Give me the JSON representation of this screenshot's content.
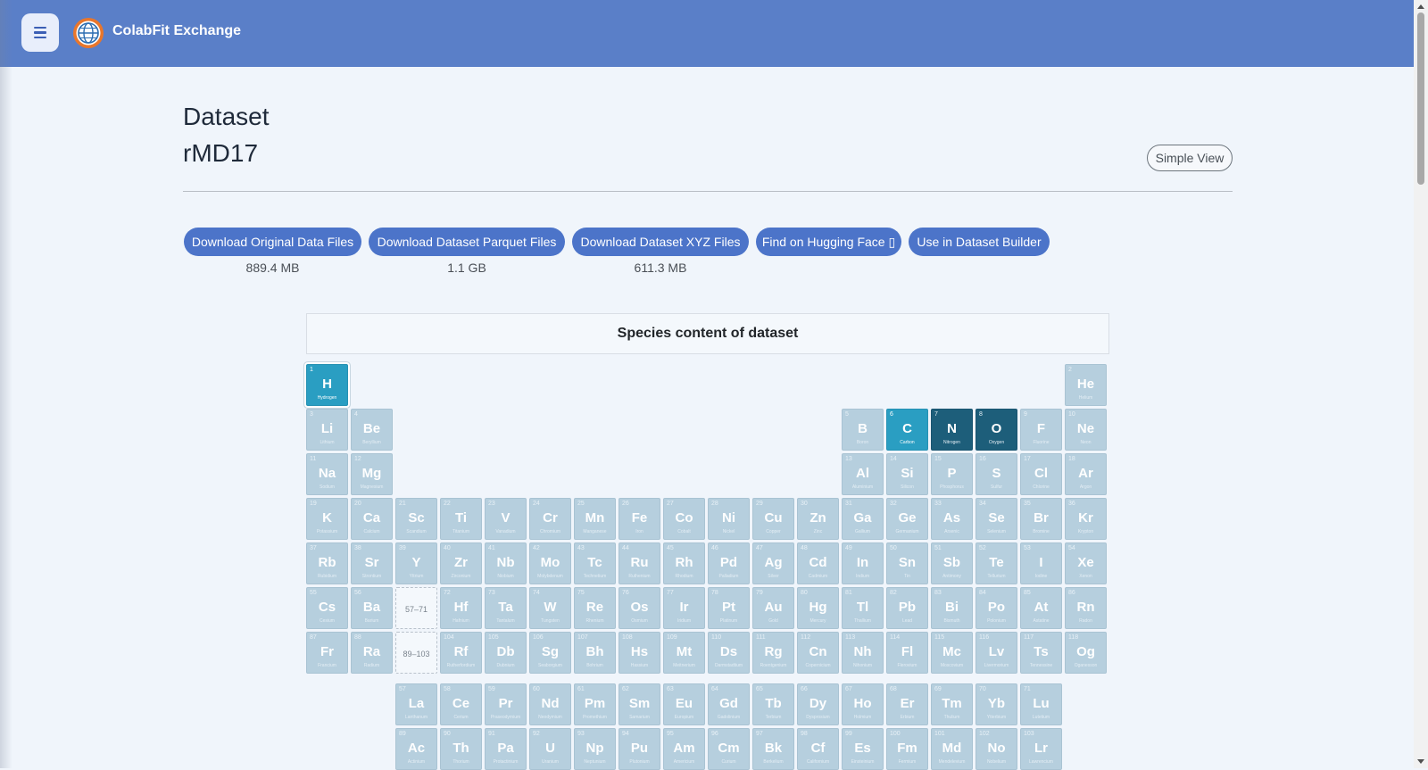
{
  "navbar": {
    "brand": "ColabFit Exchange",
    "menu_icon": "hamburger-menu-icon",
    "logo_icon": "globe-logo-icon",
    "color": "#5a7fc8"
  },
  "header": {
    "title_line1": "Dataset",
    "title_line2": "rMD17",
    "simple_view_label": "Simple View"
  },
  "downloads": [
    {
      "label": "Download Original Data Files",
      "size": "889.4 MB"
    },
    {
      "label": "Download Dataset Parquet Files",
      "size": "1.1 GB"
    },
    {
      "label": "Download Dataset XYZ Files",
      "size": "611.3 MB"
    },
    {
      "label": "Find on Hugging Face ▯",
      "size": ""
    },
    {
      "label": "Use in Dataset Builder",
      "size": ""
    }
  ],
  "species_title": "Species content of dataset",
  "colors": {
    "present": "#2a9ec2",
    "present_dark": "#1d5e7a",
    "absent": "#b6cfde"
  },
  "present_elements": [
    "H",
    "C",
    "N",
    "O"
  ],
  "elements": [
    [
      "H",
      "Hydrogen"
    ],
    [
      "He",
      "Helium"
    ],
    [
      "Li",
      "Lithium"
    ],
    [
      "Be",
      "Beryllium"
    ],
    [
      "B",
      "Boron"
    ],
    [
      "C",
      "Carbon"
    ],
    [
      "N",
      "Nitrogen"
    ],
    [
      "O",
      "Oxygen"
    ],
    [
      "F",
      "Fluorine"
    ],
    [
      "Ne",
      "Neon"
    ],
    [
      "Na",
      "Sodium"
    ],
    [
      "Mg",
      "Magnesium"
    ],
    [
      "Al",
      "Aluminium"
    ],
    [
      "Si",
      "Silicon"
    ],
    [
      "P",
      "Phosphorus"
    ],
    [
      "S",
      "Sulfur"
    ],
    [
      "Cl",
      "Chlorine"
    ],
    [
      "Ar",
      "Argon"
    ],
    [
      "K",
      "Potassium"
    ],
    [
      "Ca",
      "Calcium"
    ],
    [
      "Sc",
      "Scandium"
    ],
    [
      "Ti",
      "Titanium"
    ],
    [
      "V",
      "Vanadium"
    ],
    [
      "Cr",
      "Chromium"
    ],
    [
      "Mn",
      "Manganese"
    ],
    [
      "Fe",
      "Iron"
    ],
    [
      "Co",
      "Cobalt"
    ],
    [
      "Ni",
      "Nickel"
    ],
    [
      "Cu",
      "Copper"
    ],
    [
      "Zn",
      "Zinc"
    ],
    [
      "Ga",
      "Gallium"
    ],
    [
      "Ge",
      "Germanium"
    ],
    [
      "As",
      "Arsenic"
    ],
    [
      "Se",
      "Selenium"
    ],
    [
      "Br",
      "Bromine"
    ],
    [
      "Kr",
      "Krypton"
    ],
    [
      "Rb",
      "Rubidium"
    ],
    [
      "Sr",
      "Strontium"
    ],
    [
      "Y",
      "Yttrium"
    ],
    [
      "Zr",
      "Zirconium"
    ],
    [
      "Nb",
      "Niobium"
    ],
    [
      "Mo",
      "Molybdenum"
    ],
    [
      "Tc",
      "Technetium"
    ],
    [
      "Ru",
      "Ruthenium"
    ],
    [
      "Rh",
      "Rhodium"
    ],
    [
      "Pd",
      "Palladium"
    ],
    [
      "Ag",
      "Silver"
    ],
    [
      "Cd",
      "Cadmium"
    ],
    [
      "In",
      "Indium"
    ],
    [
      "Sn",
      "Tin"
    ],
    [
      "Sb",
      "Antimony"
    ],
    [
      "Te",
      "Tellurium"
    ],
    [
      "I",
      "Iodine"
    ],
    [
      "Xe",
      "Xenon"
    ],
    [
      "Cs",
      "Cesium"
    ],
    [
      "Ba",
      "Barium"
    ],
    [
      "La",
      "Lanthanum"
    ],
    [
      "Ce",
      "Cerium"
    ],
    [
      "Pr",
      "Praseodymium"
    ],
    [
      "Nd",
      "Neodymium"
    ],
    [
      "Pm",
      "Promethium"
    ],
    [
      "Sm",
      "Samarium"
    ],
    [
      "Eu",
      "Europium"
    ],
    [
      "Gd",
      "Gadolinium"
    ],
    [
      "Tb",
      "Terbium"
    ],
    [
      "Dy",
      "Dysprosium"
    ],
    [
      "Ho",
      "Holmium"
    ],
    [
      "Er",
      "Erbium"
    ],
    [
      "Tm",
      "Thulium"
    ],
    [
      "Yb",
      "Ytterbium"
    ],
    [
      "Lu",
      "Lutetium"
    ],
    [
      "Hf",
      "Hafnium"
    ],
    [
      "Ta",
      "Tantalum"
    ],
    [
      "W",
      "Tungsten"
    ],
    [
      "Re",
      "Rhenium"
    ],
    [
      "Os",
      "Osmium"
    ],
    [
      "Ir",
      "Iridium"
    ],
    [
      "Pt",
      "Platinum"
    ],
    [
      "Au",
      "Gold"
    ],
    [
      "Hg",
      "Mercury"
    ],
    [
      "Tl",
      "Thallium"
    ],
    [
      "Pb",
      "Lead"
    ],
    [
      "Bi",
      "Bismuth"
    ],
    [
      "Po",
      "Polonium"
    ],
    [
      "At",
      "Astatine"
    ],
    [
      "Rn",
      "Radon"
    ],
    [
      "Fr",
      "Francium"
    ],
    [
      "Ra",
      "Radium"
    ],
    [
      "Ac",
      "Actinium"
    ],
    [
      "Th",
      "Thorium"
    ],
    [
      "Pa",
      "Protactinium"
    ],
    [
      "U",
      "Uranium"
    ],
    [
      "Np",
      "Neptunium"
    ],
    [
      "Pu",
      "Plutonium"
    ],
    [
      "Am",
      "Americium"
    ],
    [
      "Cm",
      "Curium"
    ],
    [
      "Bk",
      "Berkelium"
    ],
    [
      "Cf",
      "Californium"
    ],
    [
      "Es",
      "Einsteinium"
    ],
    [
      "Fm",
      "Fermium"
    ],
    [
      "Md",
      "Mendelevium"
    ],
    [
      "No",
      "Nobelium"
    ],
    [
      "Lr",
      "Lawrencium"
    ],
    [
      "Rf",
      "Rutherfordium"
    ],
    [
      "Db",
      "Dubnium"
    ],
    [
      "Sg",
      "Seaborgium"
    ],
    [
      "Bh",
      "Bohrium"
    ],
    [
      "Hs",
      "Hassium"
    ],
    [
      "Mt",
      "Meitnerium"
    ],
    [
      "Ds",
      "Darmstadtium"
    ],
    [
      "Rg",
      "Roentgenium"
    ],
    [
      "Cn",
      "Copernicium"
    ],
    [
      "Nh",
      "Nihonium"
    ],
    [
      "Fl",
      "Flerovium"
    ],
    [
      "Mc",
      "Moscovium"
    ],
    [
      "Lv",
      "Livermorium"
    ],
    [
      "Ts",
      "Tennessine"
    ],
    [
      "Og",
      "Oganesson"
    ]
  ],
  "placeholders": [
    "57–71",
    "89–103"
  ]
}
